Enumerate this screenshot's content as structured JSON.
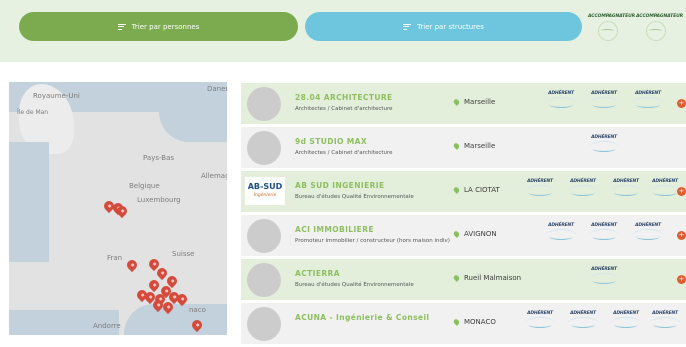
{
  "filters": {
    "by_people_label": "Trier par personnes",
    "by_structures_label": "Trier par structures"
  },
  "legend": [
    {
      "label": "ACCOMPAGNATEUR"
    },
    {
      "label": "ACCOMPAGNATEUR"
    }
  ],
  "map": {
    "labels": [
      "Royaume-Uni",
      "Île de Man",
      "Danemar",
      "Pays-Bas",
      "Allemag",
      "Belgique",
      "Luxembourg",
      "Fran",
      "Suisse",
      "naco",
      "Andorre"
    ]
  },
  "badge_label": "ADHÉRENT",
  "structures": [
    {
      "name": "28.04 ARCHITECTURE",
      "category": "Architectes / Cabinet d'architecture",
      "city": "Marseille"
    },
    {
      "name": "9d STUDIO MAX",
      "category": "Architectes / Cabinet d'architecture",
      "city": "Marseille"
    },
    {
      "name": "AB SUD INGENIERIE",
      "category": "Bureau d'études Qualité Environnementale",
      "city": "LA CIOTAT",
      "logo": {
        "main": "AB-SUD",
        "sub": "Ingénierie"
      }
    },
    {
      "name": "ACI IMMOBILIERE",
      "category": "Promoteur immobilier / constructeur (hors maison indiv)",
      "city": "AVIGNON"
    },
    {
      "name": "ACTIERRA",
      "category": "Bureau d'études Qualité Environnementale",
      "city": "Rueil Malmaison"
    },
    {
      "name": "ACUNA - Ingénierie & Conseil",
      "category": "",
      "city": "MONACO"
    }
  ],
  "colors": {
    "green": "#7cab4f",
    "blue": "#6ec6de",
    "pin": "#d44a3b",
    "more": "#e05a2e"
  }
}
